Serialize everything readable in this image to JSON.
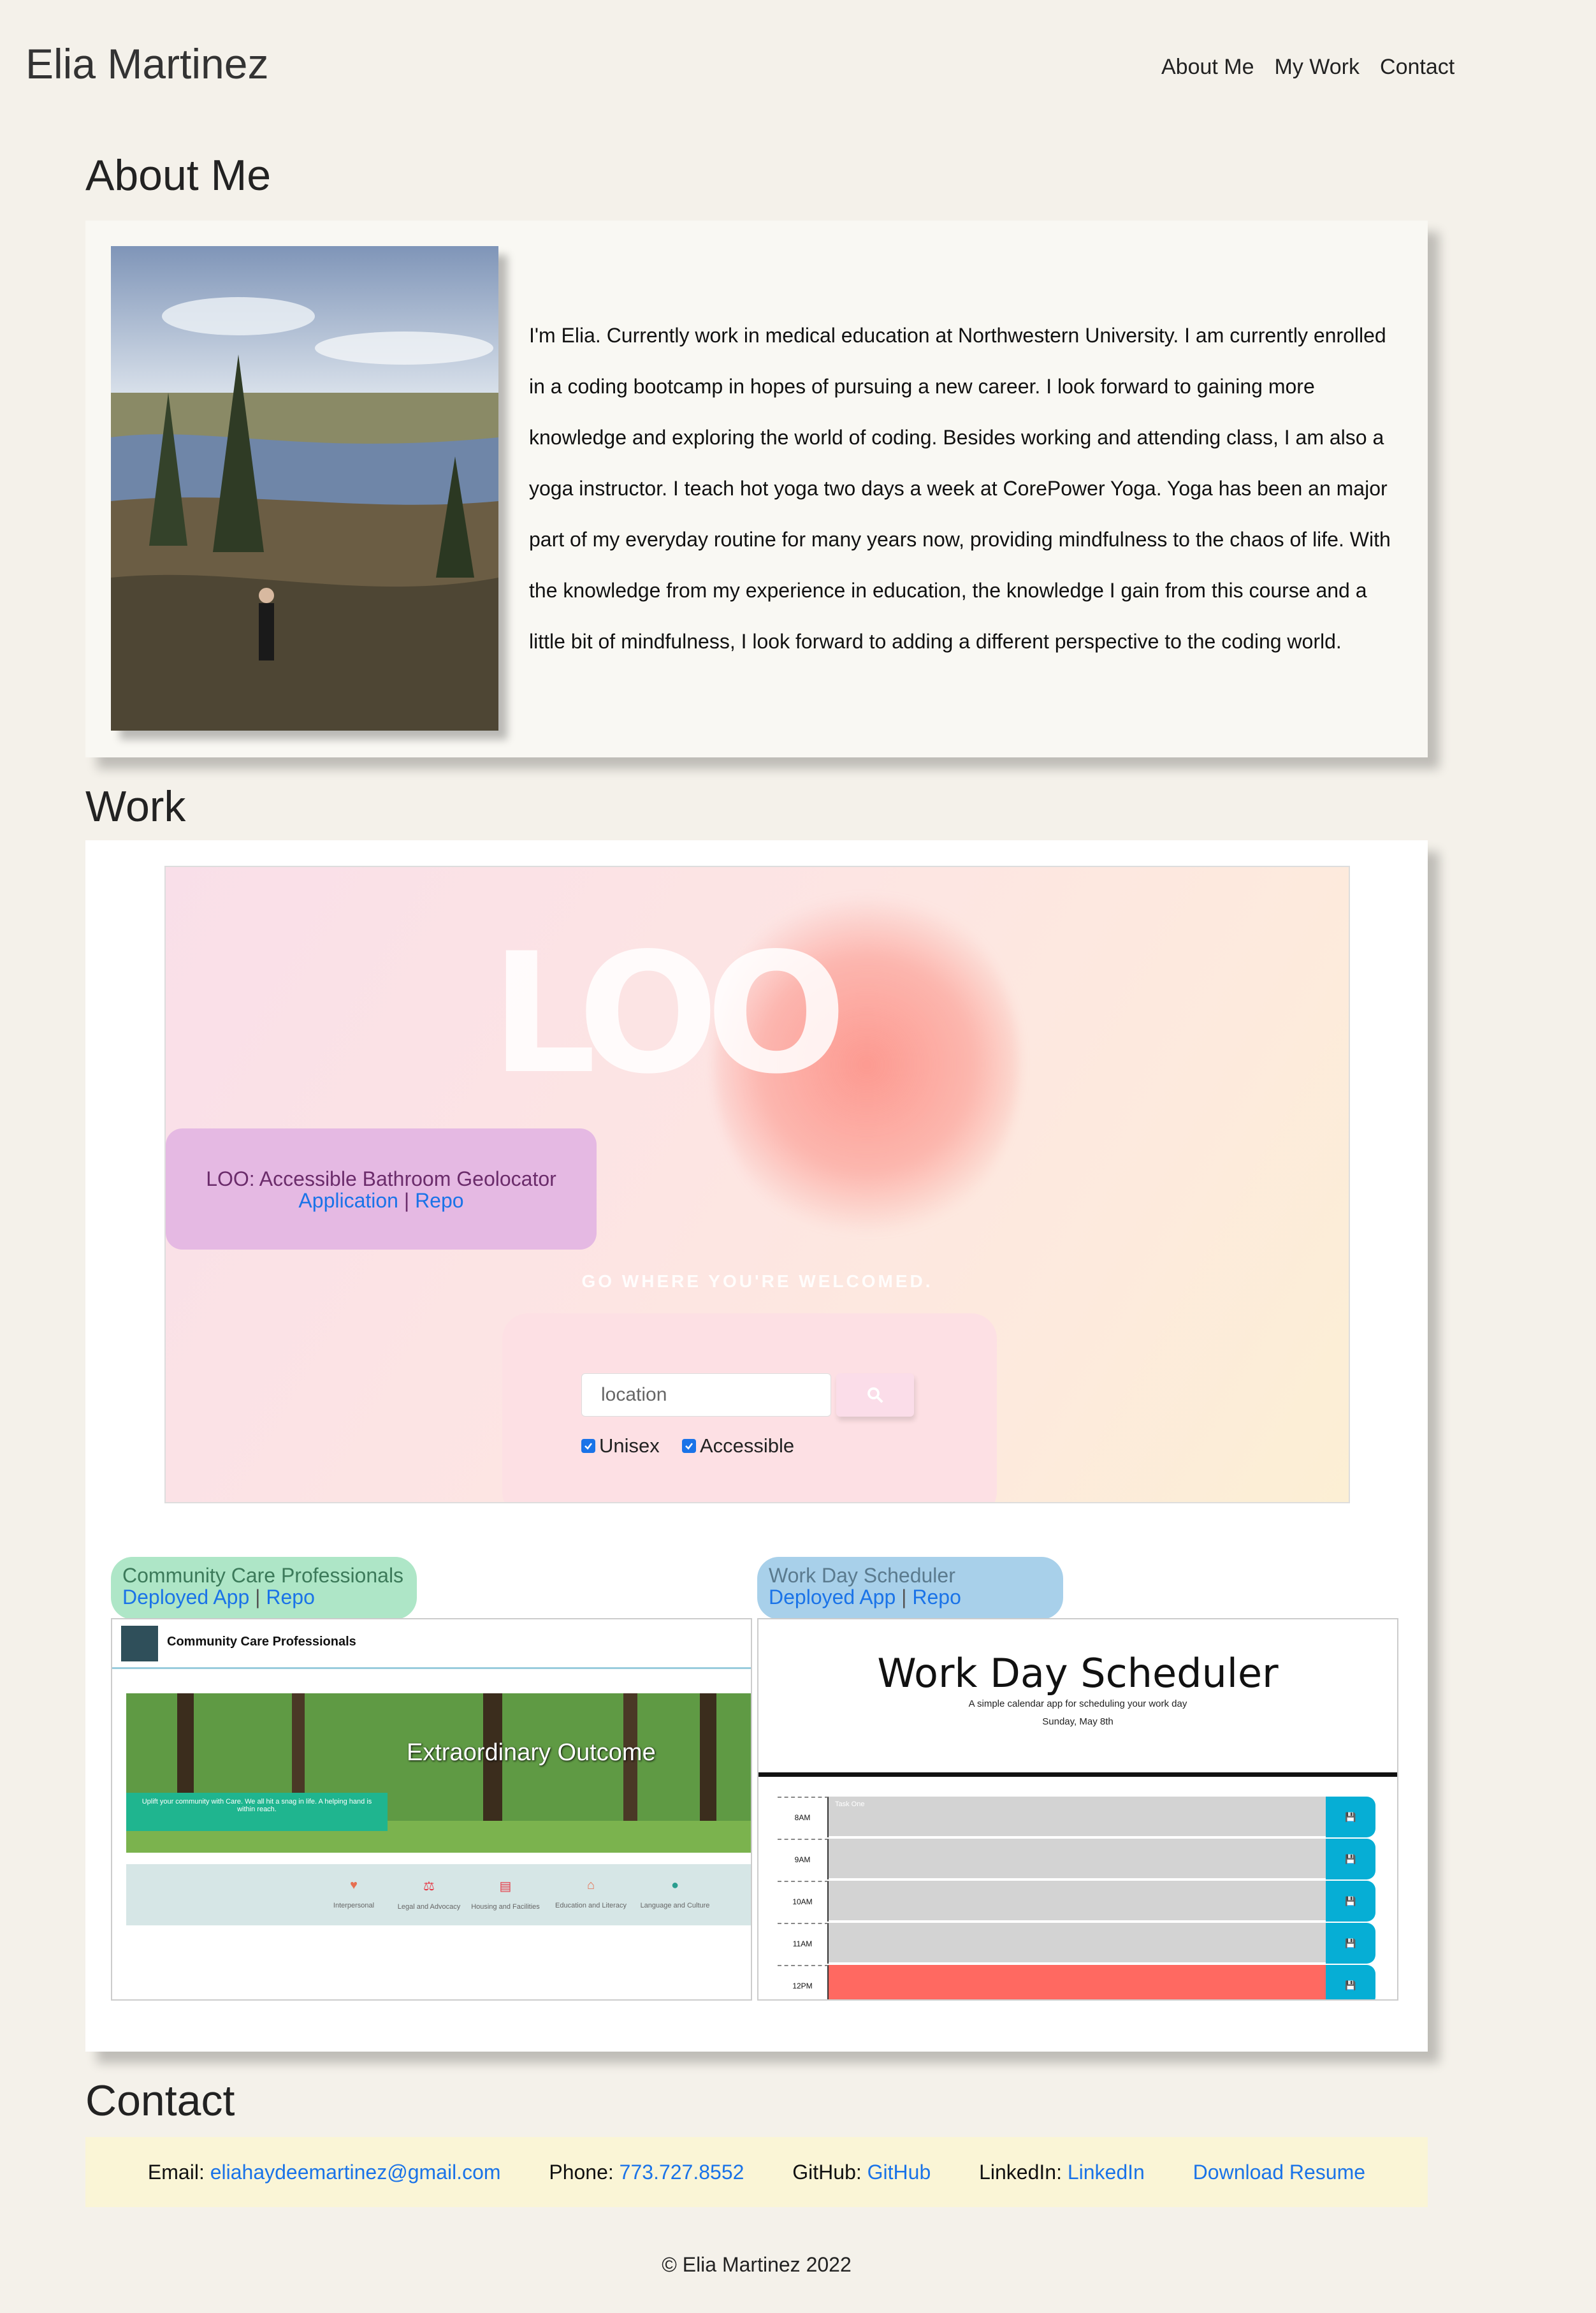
{
  "header": {
    "site_title": "Elia Martinez",
    "nav": [
      "About Me",
      "My Work",
      "Contact"
    ]
  },
  "about": {
    "heading": "About Me",
    "text": "I'm Elia. Currently work in medical education at Northwestern University. I am currently enrolled in a coding bootcamp in hopes of pursuing a new career. I look forward to gaining more knowledge and exploring the world of coding. Besides working and attending class, I am also a yoga instructor. I teach hot yoga two days a week at CorePower Yoga. Yoga has been an major part of my everyday routine for many years now, providing mindfulness to the chaos of life. With the knowledge from my experience in education, the knowledge I gain from this course and a little bit of mindfulness, I look forward to adding a different perspective to the coding world."
  },
  "work": {
    "heading": "Work",
    "loo": {
      "logo": "LOO",
      "title": "LOO: Accessible Bathroom Geolocator",
      "link1": "Application",
      "separator": "|",
      "link2": "Repo",
      "tagline": "GO WHERE YOU'RE WELCOMED.",
      "search_placeholder": "location",
      "check1": "Unisex",
      "check2": "Accessible"
    },
    "ccp": {
      "title": "Community Care Professionals",
      "link1": "Deployed App",
      "separator": "|",
      "link2": "Repo",
      "mock_name": "Community Care Professionals",
      "hero_title": "Extraordinary Outcome",
      "hero_text": "Uplift your community with Care. We all hit a snag in life. A helping hand is within reach.",
      "categories": [
        "Interpersonal",
        "Legal and Advocacy",
        "Housing and Facilities",
        "Education and Literacy",
        "Language and Culture"
      ]
    },
    "scheduler": {
      "title": "Work Day Scheduler",
      "link1": "Deployed App",
      "separator": "|",
      "link2": "Repo",
      "mock_title": "Work Day Scheduler",
      "mock_sub": "A simple calendar app for scheduling your work day",
      "mock_date": "Sunday, May 8th",
      "rows": [
        {
          "hour": "8AM",
          "text": "Task One",
          "state": "past"
        },
        {
          "hour": "9AM",
          "text": "",
          "state": "past"
        },
        {
          "hour": "10AM",
          "text": "",
          "state": "past"
        },
        {
          "hour": "11AM",
          "text": "",
          "state": "past"
        },
        {
          "hour": "12PM",
          "text": "",
          "state": "present"
        }
      ]
    }
  },
  "contact": {
    "heading": "Contact",
    "email_label": "Email:",
    "email": "eliahaydeemartinez@gmail.com",
    "phone_label": "Phone:",
    "phone": "773.727.8552",
    "github_label": "GitHub:",
    "github": "GitHub",
    "linkedin_label": "LinkedIn:",
    "linkedin": "LinkedIn",
    "resume": "Download Resume"
  },
  "footer": "© Elia Martinez 2022",
  "colors": {
    "page_bg": "#f4f1ea",
    "link": "#1a73e8",
    "loo_caption_bg": "#e5b9e3",
    "ccp_label_bg": "#aee6c7",
    "scheduler_label_bg": "#a8d0ea",
    "contact_bg": "#faf5d6"
  }
}
